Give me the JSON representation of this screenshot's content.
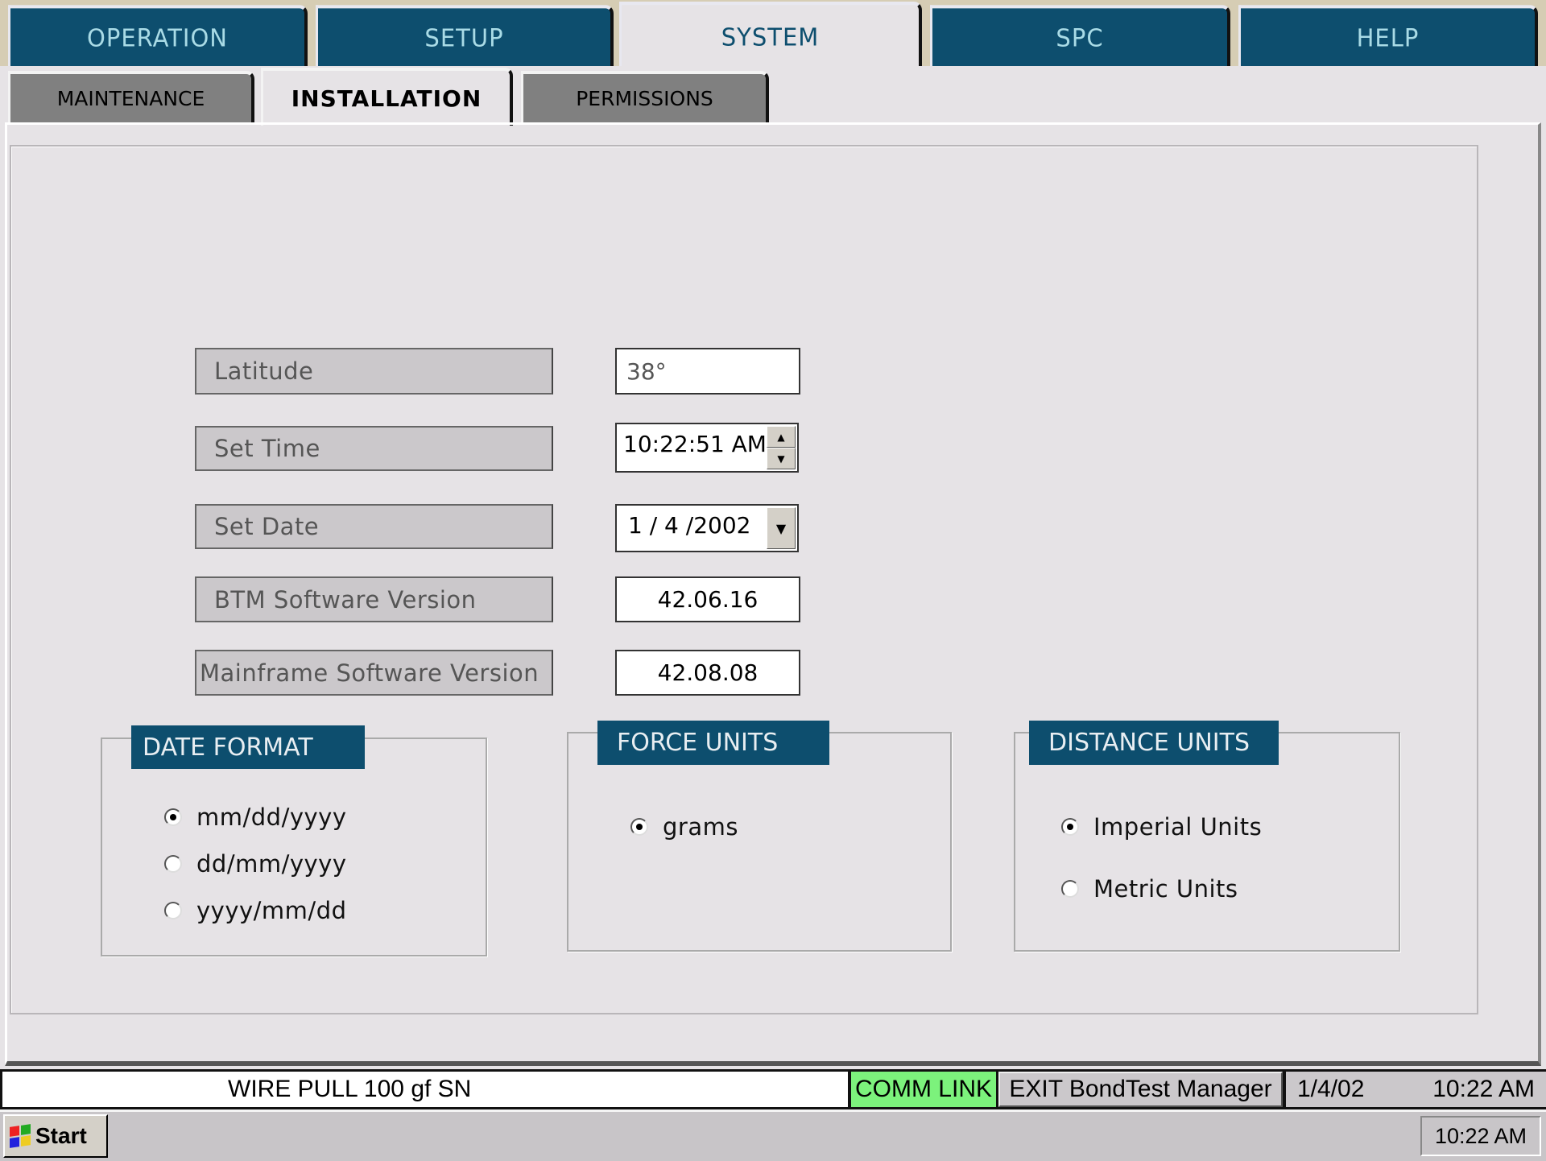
{
  "main_tabs": [
    {
      "label": "OPERATION"
    },
    {
      "label": "SETUP"
    },
    {
      "label": "SYSTEM",
      "active": true
    },
    {
      "label": "SPC"
    },
    {
      "label": "HELP"
    }
  ],
  "sub_tabs": [
    {
      "label": "MAINTENANCE"
    },
    {
      "label": "INSTALLATION",
      "active": true
    },
    {
      "label": "PERMISSIONS"
    }
  ],
  "fields": {
    "latitude": {
      "label": "Latitude",
      "value": "38°"
    },
    "time": {
      "label": "Set Time",
      "value": "10:22:51 AM"
    },
    "date": {
      "label": "Set Date",
      "value": "1 / 4 /2002"
    },
    "btm": {
      "label": "BTM Software Version",
      "value": "42.06.16"
    },
    "mainframe": {
      "label": "Mainframe Software Version",
      "value": "42.08.08"
    }
  },
  "date_format": {
    "title": "DATE FORMAT",
    "options": [
      "mm/dd/yyyy",
      "dd/mm/yyyy",
      "yyyy/mm/dd"
    ],
    "selected": "mm/dd/yyyy"
  },
  "force_units": {
    "title": "FORCE UNITS",
    "options": [
      "grams"
    ],
    "selected": "grams"
  },
  "distance_units": {
    "title": "DISTANCE UNITS",
    "options": [
      "Imperial Units",
      "Metric Units"
    ],
    "selected": "Imperial Units"
  },
  "status_bar": {
    "test": "WIRE PULL 100 gf   SN",
    "comm": "COMM LINK",
    "exit": "EXIT BondTest Manager",
    "date": "1/4/02",
    "time": "10:22 AM",
    "comm_color": "#7cf27c"
  },
  "taskbar": {
    "start": "Start",
    "clock": "10:22 AM"
  }
}
